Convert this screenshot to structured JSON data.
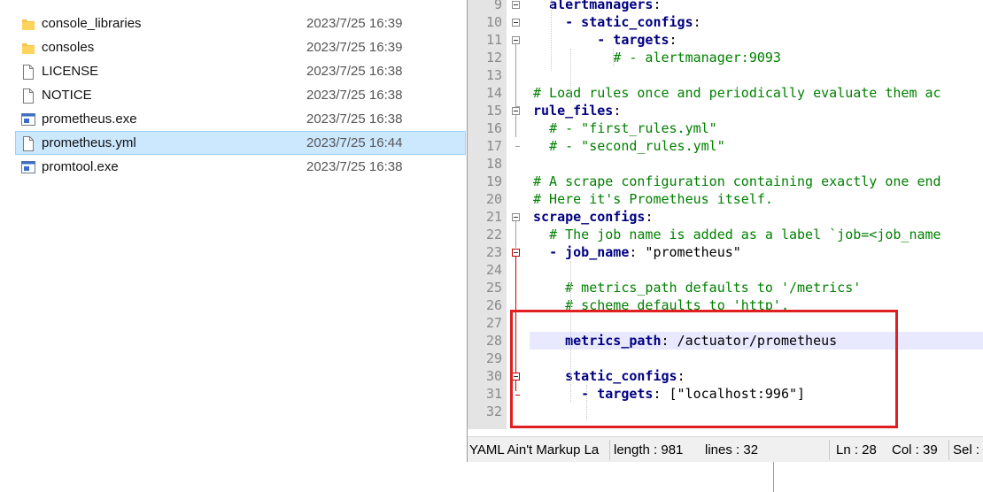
{
  "explorer": {
    "files": [
      {
        "name": "console_libraries",
        "date": "2023/7/25 16:39",
        "icon": "folder-icon",
        "type": "folder",
        "selected": false
      },
      {
        "name": "consoles",
        "date": "2023/7/25 16:39",
        "icon": "folder-icon",
        "type": "folder",
        "selected": false
      },
      {
        "name": "LICENSE",
        "date": "2023/7/25 16:38",
        "icon": "file-icon",
        "type": "file",
        "selected": false
      },
      {
        "name": "NOTICE",
        "date": "2023/7/25 16:38",
        "icon": "file-icon",
        "type": "file",
        "selected": false
      },
      {
        "name": "prometheus.exe",
        "date": "2023/7/25 16:38",
        "icon": "exe-icon",
        "type": "exe",
        "selected": false
      },
      {
        "name": "prometheus.yml",
        "date": "2023/7/25 16:44",
        "icon": "file-icon",
        "type": "file",
        "selected": true
      },
      {
        "name": "promtool.exe",
        "date": "2023/7/25 16:38",
        "icon": "exe-icon",
        "type": "exe",
        "selected": false
      }
    ]
  },
  "editor": {
    "current_line": 28,
    "lines": [
      {
        "num": "9",
        "indent": "  ",
        "key": "alertmanagers",
        "rest": ":",
        "comment": ""
      },
      {
        "num": "10",
        "indent": "    ",
        "key": "- static_configs",
        "rest": ":",
        "comment": ""
      },
      {
        "num": "11",
        "indent": "        ",
        "key": "- targets",
        "rest": ":",
        "comment": ""
      },
      {
        "num": "12",
        "indent": "          ",
        "key": "",
        "rest": "",
        "comment": "# - alertmanager:9093"
      },
      {
        "num": "13",
        "indent": "",
        "key": "",
        "rest": "",
        "comment": ""
      },
      {
        "num": "14",
        "indent": "",
        "key": "",
        "rest": "",
        "comment": "# Load rules once and periodically evaluate them ac"
      },
      {
        "num": "15",
        "indent": "",
        "key": "rule_files",
        "rest": ":",
        "comment": ""
      },
      {
        "num": "16",
        "indent": "  ",
        "key": "",
        "rest": "",
        "comment": "# - \"first_rules.yml\""
      },
      {
        "num": "17",
        "indent": "  ",
        "key": "",
        "rest": "",
        "comment": "# - \"second_rules.yml\""
      },
      {
        "num": "18",
        "indent": "",
        "key": "",
        "rest": "",
        "comment": ""
      },
      {
        "num": "19",
        "indent": "",
        "key": "",
        "rest": "",
        "comment": "# A scrape configuration containing exactly one end"
      },
      {
        "num": "20",
        "indent": "",
        "key": "",
        "rest": "",
        "comment": "# Here it's Prometheus itself."
      },
      {
        "num": "21",
        "indent": "",
        "key": "scrape_configs",
        "rest": ":",
        "comment": ""
      },
      {
        "num": "22",
        "indent": "  ",
        "key": "",
        "rest": "",
        "comment": "# The job name is added as a label `job=<job_name"
      },
      {
        "num": "23",
        "indent": "  ",
        "key": "- job_name",
        "rest": ": \"prometheus\"",
        "comment": ""
      },
      {
        "num": "24",
        "indent": "",
        "key": "",
        "rest": "",
        "comment": ""
      },
      {
        "num": "25",
        "indent": "    ",
        "key": "",
        "rest": "",
        "comment": "# metrics_path defaults to '/metrics'"
      },
      {
        "num": "26",
        "indent": "    ",
        "key": "",
        "rest": "",
        "comment": "# scheme defaults to 'http'."
      },
      {
        "num": "27",
        "indent": "",
        "key": "",
        "rest": "",
        "comment": ""
      },
      {
        "num": "28",
        "indent": "    ",
        "key": "metrics_path",
        "rest": ": /actuator/prometheus",
        "comment": ""
      },
      {
        "num": "29",
        "indent": "",
        "key": "",
        "rest": "",
        "comment": ""
      },
      {
        "num": "30",
        "indent": "    ",
        "key": "static_configs",
        "rest": ":",
        "comment": ""
      },
      {
        "num": "31",
        "indent": "      ",
        "key": "- targets",
        "rest": ": [\"localhost:996\"]",
        "comment": ""
      },
      {
        "num": "32",
        "indent": "",
        "key": "",
        "rest": "",
        "comment": ""
      }
    ]
  },
  "statusbar": {
    "language": "YAML Ain't Markup La",
    "length": "length : 981",
    "lines": "lines : 32",
    "ln": "Ln : 28",
    "col": "Col : 39",
    "sel": "Sel :"
  },
  "colors": {
    "selection": "#cce8ff",
    "key": "#000080",
    "comment": "#008000",
    "annotation": "#e02020"
  }
}
